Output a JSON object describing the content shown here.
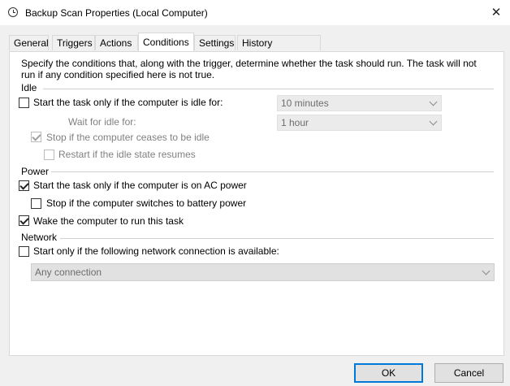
{
  "window": {
    "title": "Backup Scan Properties (Local Computer)"
  },
  "tabs": [
    "General",
    "Triggers",
    "Actions",
    "Conditions",
    "Settings",
    "History (disabled)"
  ],
  "description": "Specify the conditions that, along with the trigger, determine whether the task should run.  The task will not run  if any condition specified here is not true.",
  "idle": {
    "label": "Idle",
    "start_if_idle": {
      "label": "Start the task only if the computer is idle for:",
      "checked": false
    },
    "idle_duration": "10 minutes",
    "wait_label": "Wait for idle for:",
    "wait_duration": "1 hour",
    "stop_if_not_idle": {
      "label": "Stop if the computer ceases to be idle",
      "checked": true
    },
    "restart_if_idle": {
      "label": "Restart if the idle state resumes",
      "checked": false
    }
  },
  "power": {
    "label": "Power",
    "ac_only": {
      "label": "Start the task only if the computer is on AC power",
      "checked": true
    },
    "stop_on_battery": {
      "label": "Stop if the computer switches to battery power",
      "checked": false
    },
    "wake": {
      "label": "Wake the computer to run this task",
      "checked": true
    }
  },
  "network": {
    "label": "Network",
    "start_if_network": {
      "label": "Start only if the following network connection is available:",
      "checked": false
    },
    "connection": "Any connection"
  },
  "buttons": {
    "ok": "OK",
    "cancel": "Cancel"
  }
}
